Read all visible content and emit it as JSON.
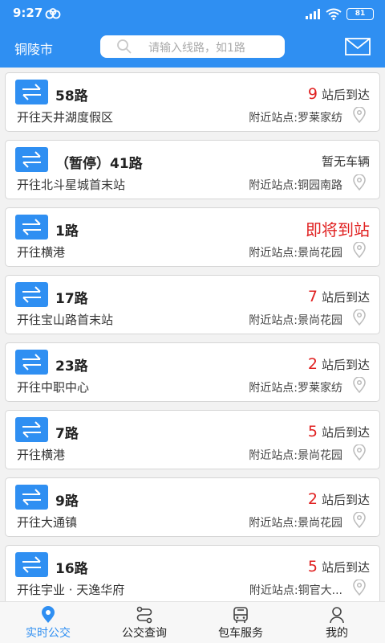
{
  "status_bar": {
    "time": "9:27",
    "battery": "81",
    "icons": [
      "app-logo-icon",
      "signal-icon",
      "wifi-icon",
      "battery-icon"
    ]
  },
  "header": {
    "city": "铜陵市",
    "search_placeholder": "请输入线路，如1路",
    "icons": [
      "search-icon",
      "mail-icon"
    ]
  },
  "routes": [
    {
      "name": "58路",
      "destination": "开往天井湖度假区",
      "arrival_count": "9",
      "arrival_suffix": "站后到达",
      "nearby": "附近站点:罗莱家纺"
    },
    {
      "name": "（暂停）41路",
      "destination": "开往北斗星城首末站",
      "arrival_text": "暂无车辆",
      "nearby": "附近站点:铜园南路"
    },
    {
      "name": "1路",
      "destination": "开往横港",
      "arrival_soon": "即将到站",
      "nearby": "附近站点:景尚花园"
    },
    {
      "name": "17路",
      "destination": "开往宝山路首末站",
      "arrival_count": "7",
      "arrival_suffix": "站后到达",
      "nearby": "附近站点:景尚花园"
    },
    {
      "name": "23路",
      "destination": "开往中职中心",
      "arrival_count": "2",
      "arrival_suffix": "站后到达",
      "nearby": "附近站点:罗莱家纺"
    },
    {
      "name": "7路",
      "destination": "开往横港",
      "arrival_count": "5",
      "arrival_suffix": "站后到达",
      "nearby": "附近站点:景尚花园"
    },
    {
      "name": "9路",
      "destination": "开往大通镇",
      "arrival_count": "2",
      "arrival_suffix": "站后到达",
      "nearby": "附近站点:景尚花园"
    },
    {
      "name": "16路",
      "destination": "开往宇业 · 天逸华府",
      "arrival_count": "5",
      "arrival_suffix": "站后到达",
      "nearby": "附近站点:铜官大..."
    }
  ],
  "bottom_nav": [
    {
      "label": "实时公交",
      "icon": "location-pin-icon",
      "active": true
    },
    {
      "label": "公交查询",
      "icon": "route-path-icon",
      "active": false
    },
    {
      "label": "包车服务",
      "icon": "bus-icon",
      "active": false
    },
    {
      "label": "我的",
      "icon": "user-icon",
      "active": false
    }
  ],
  "colors": {
    "primary": "#2f8ff2",
    "alert": "#e02020"
  }
}
